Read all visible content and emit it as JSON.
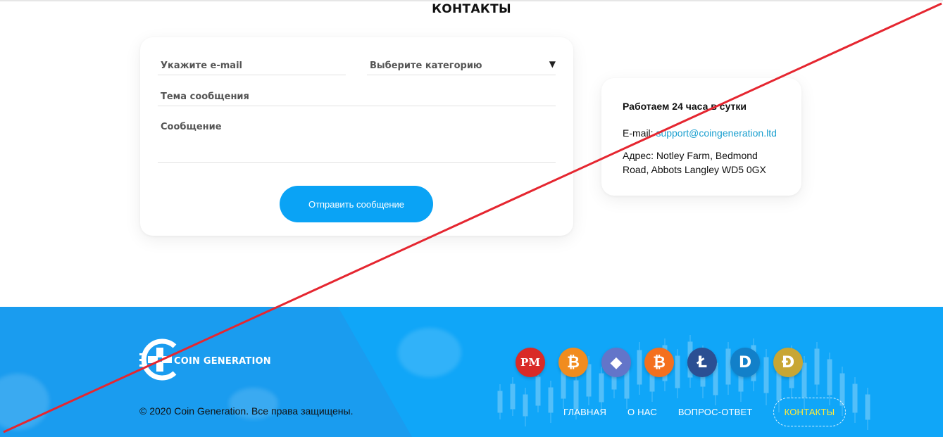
{
  "page": {
    "title": "КОНТАКТЫ"
  },
  "form": {
    "email_placeholder": "Укажите e-mail",
    "category_placeholder": "Выберите категорию",
    "category_caret": "▼",
    "subject_placeholder": "Тема сообщения",
    "message_placeholder": "Сообщение",
    "submit_label": "Отправить сообщение"
  },
  "info": {
    "hours": "Работаем 24 часа в сутки",
    "email_label": "E-mail:",
    "email_value": "support@coingeneration.ltd",
    "address": "Адрес: Notley Farm, Bedmond Road, Abbots Langley WD5 0GX"
  },
  "footer": {
    "logo_text": "COIN GENERATION",
    "copyright": "© 2020 Coin Generation. Все права защищены.",
    "coins": [
      {
        "name": "perfect-money-icon",
        "glyph": "PM",
        "color": "#d92a27"
      },
      {
        "name": "bitcoin-icon",
        "glyph": "₿",
        "color": "#f18c1f"
      },
      {
        "name": "ethereum-icon",
        "glyph": "◆",
        "color": "#6375c9"
      },
      {
        "name": "bitcoin-cash-icon",
        "glyph": "₿",
        "color": "#f4701e"
      },
      {
        "name": "litecoin-icon",
        "glyph": "Ł",
        "color": "#2b4f93"
      },
      {
        "name": "dash-icon",
        "glyph": "D",
        "color": "#1280c9"
      },
      {
        "name": "dogecoin-icon",
        "glyph": "Ð",
        "color": "#c8a634"
      }
    ],
    "nav": [
      {
        "name": "nav-home",
        "label": "ГЛАВНАЯ"
      },
      {
        "name": "nav-about",
        "label": "О НАС"
      },
      {
        "name": "nav-faq",
        "label": "ВОПРОС-ОТВЕТ"
      },
      {
        "name": "nav-contacts",
        "label": "КОНТАКТЫ",
        "active": true
      }
    ]
  },
  "colors": {
    "accent": "#0aa3f5",
    "footer_bg": "#10a6f8",
    "link": "#1a9fcf",
    "active_nav": "#ffeb3b",
    "strike_line": "#e52630"
  }
}
